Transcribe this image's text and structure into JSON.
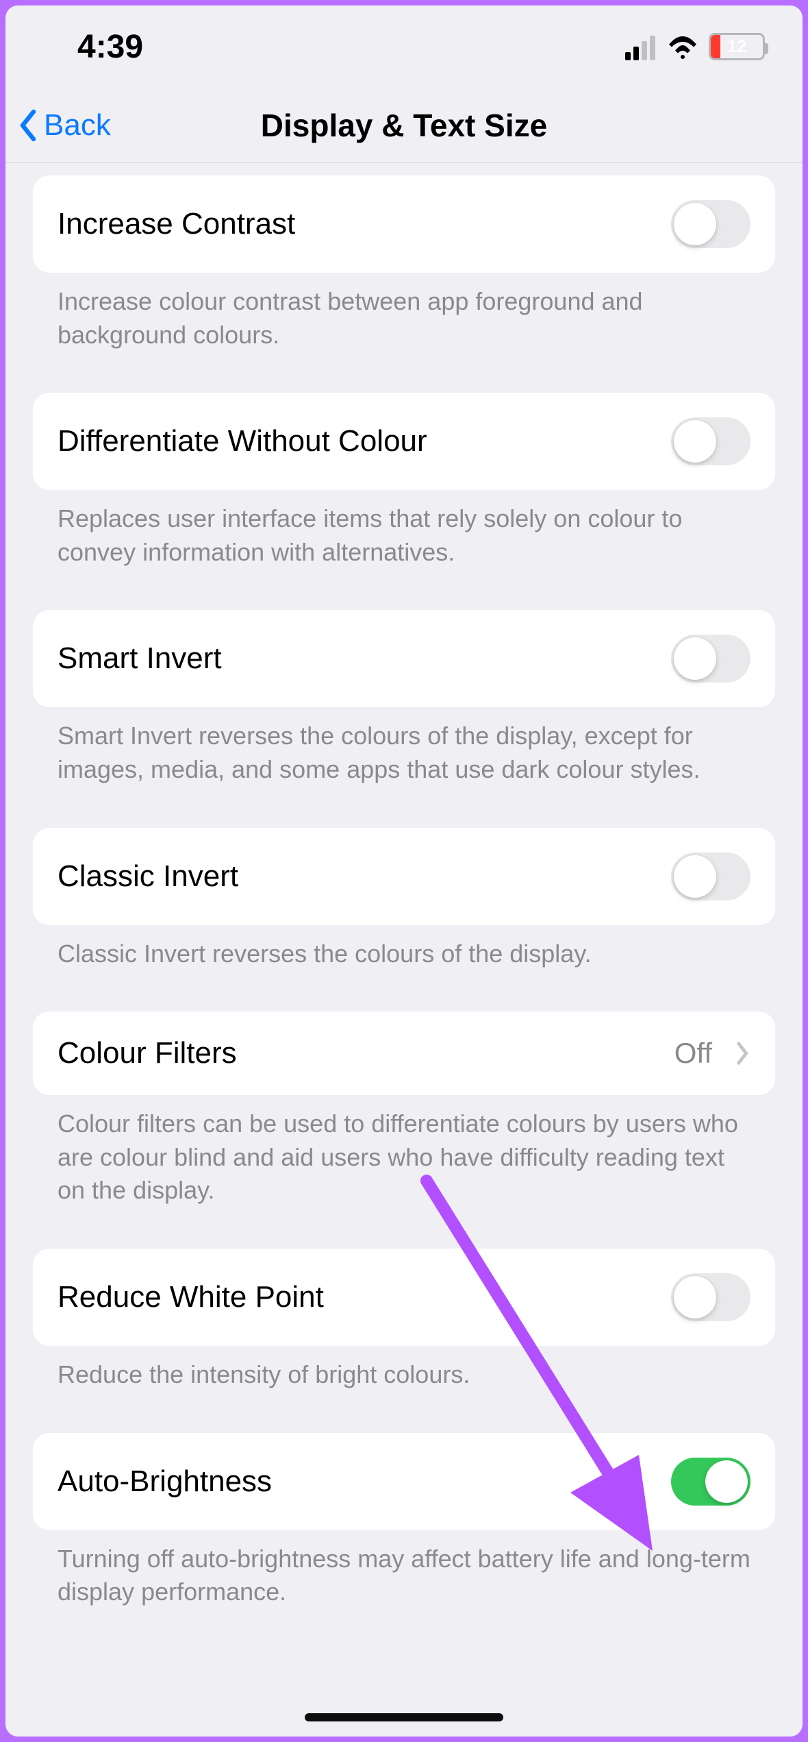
{
  "status": {
    "time": "4:39",
    "battery_pct": "12"
  },
  "nav": {
    "back": "Back",
    "title": "Display & Text Size"
  },
  "rows": {
    "increase_contrast": {
      "label": "Increase Contrast",
      "on": false,
      "desc": "Increase colour contrast between app foreground and background colours."
    },
    "diff_without_colour": {
      "label": "Differentiate Without Colour",
      "on": false,
      "desc": "Replaces user interface items that rely solely on colour to convey information with alternatives."
    },
    "smart_invert": {
      "label": "Smart Invert",
      "on": false,
      "desc": "Smart Invert reverses the colours of the display, except for images, media, and some apps that use dark colour styles."
    },
    "classic_invert": {
      "label": "Classic Invert",
      "on": false,
      "desc": "Classic Invert reverses the colours of the display."
    },
    "colour_filters": {
      "label": "Colour Filters",
      "value": "Off",
      "desc": "Colour filters can be used to differentiate colours by users who are colour blind and aid users who have difficulty reading text on the display."
    },
    "reduce_white_point": {
      "label": "Reduce White Point",
      "on": false,
      "desc": "Reduce the intensity of bright colours."
    },
    "auto_brightness": {
      "label": "Auto-Brightness",
      "on": true,
      "desc": "Turning off auto-brightness may affect battery life and long-term display performance."
    }
  },
  "annotation": {
    "arrow_color": "#b24fff"
  }
}
